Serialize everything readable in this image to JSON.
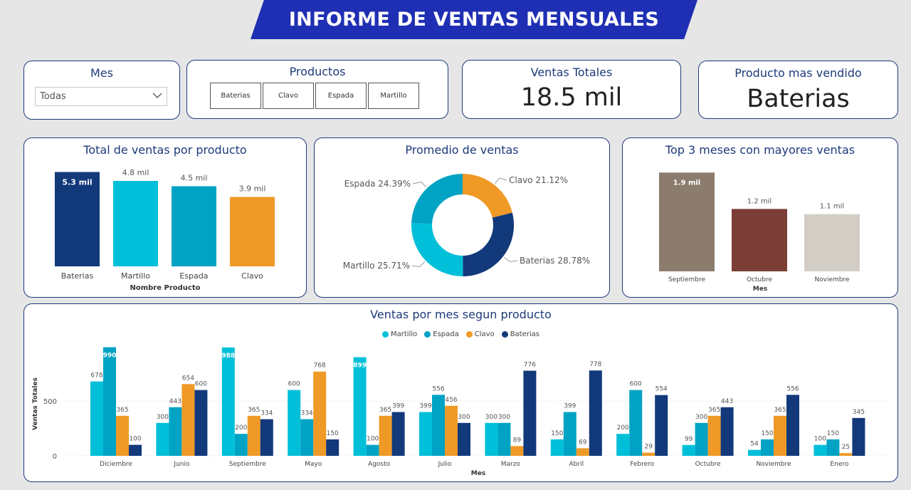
{
  "title": "INFORME DE VENTAS MENSUALES",
  "filters": {
    "mes": {
      "label": "Mes",
      "value": "Todas"
    },
    "productos": {
      "label": "Productos",
      "options": [
        "Baterias",
        "Clavo",
        "Espada",
        "Martillo"
      ]
    }
  },
  "kpis": {
    "ventas_totales": {
      "label": "Ventas Totales",
      "value": "18.5 mil"
    },
    "producto_mas_vendido": {
      "label": "Producto mas vendido",
      "value": "Baterias"
    }
  },
  "colors": {
    "martillo": "#00c0d9",
    "espada": "#00a3c4",
    "clavo": "#ef9a26",
    "baterias": "#12397a",
    "septiembre": "#8b7c6e",
    "octubre": "#7b3f37",
    "noviembre": "#d2cec6",
    "accent": "#1d3a7a"
  },
  "chart_data": [
    {
      "type": "bar",
      "title": "Total de ventas por producto",
      "xlabel": "Nombre Producto",
      "categories": [
        "Baterias",
        "Martillo",
        "Espada",
        "Clavo"
      ],
      "values": [
        5.3,
        4.8,
        4.5,
        3.9
      ],
      "labels": [
        "5.3 mil",
        "4.8 mil",
        "4.5 mil",
        "3.9 mil"
      ],
      "unit": "mil",
      "ylim": [
        0,
        5.6
      ]
    },
    {
      "type": "pie",
      "title": "Promedio de ventas",
      "categories": [
        "Clavo",
        "Baterias",
        "Martillo",
        "Espada"
      ],
      "values": [
        21.12,
        28.78,
        25.71,
        24.39
      ],
      "labels": [
        "Clavo 21.12%",
        "Baterias 28.78%",
        "Martillo 25.71%",
        "Espada 24.39%"
      ]
    },
    {
      "type": "bar",
      "title": "Top 3 meses con mayores ventas",
      "xlabel": "Mes",
      "categories": [
        "Septiembre",
        "Octubre",
        "Noviembre"
      ],
      "values": [
        1.9,
        1.2,
        1.1
      ],
      "labels": [
        "1.9 mil",
        "1.2 mil",
        "1.1 mil"
      ],
      "unit": "mil",
      "ylim": [
        0,
        2.0
      ]
    },
    {
      "type": "bar",
      "title": "Ventas por mes segun producto",
      "xlabel": "Mes",
      "ylabel": "Ventas Totales",
      "yticks": [
        0,
        500
      ],
      "ylim": [
        0,
        1000
      ],
      "categories": [
        "Diciembre",
        "Junio",
        "Septiembre",
        "Mayo",
        "Agosto",
        "Julio",
        "Marzo",
        "Abril",
        "Febrero",
        "Octubre",
        "Noviembre",
        "Enero"
      ],
      "series": [
        {
          "name": "Martillo",
          "values": [
            678,
            300,
            988,
            600,
            899,
            399,
            300,
            150,
            200,
            99,
            54,
            100
          ]
        },
        {
          "name": "Espada",
          "values": [
            990,
            443,
            200,
            334,
            100,
            556,
            300,
            399,
            600,
            300,
            150,
            150
          ]
        },
        {
          "name": "Clavo",
          "values": [
            365,
            654,
            365,
            768,
            365,
            456,
            89,
            69,
            29,
            365,
            365,
            25
          ]
        },
        {
          "name": "Baterias",
          "values": [
            100,
            600,
            334,
            150,
            399,
            300,
            776,
            778,
            554,
            443,
            556,
            345
          ]
        }
      ]
    }
  ]
}
